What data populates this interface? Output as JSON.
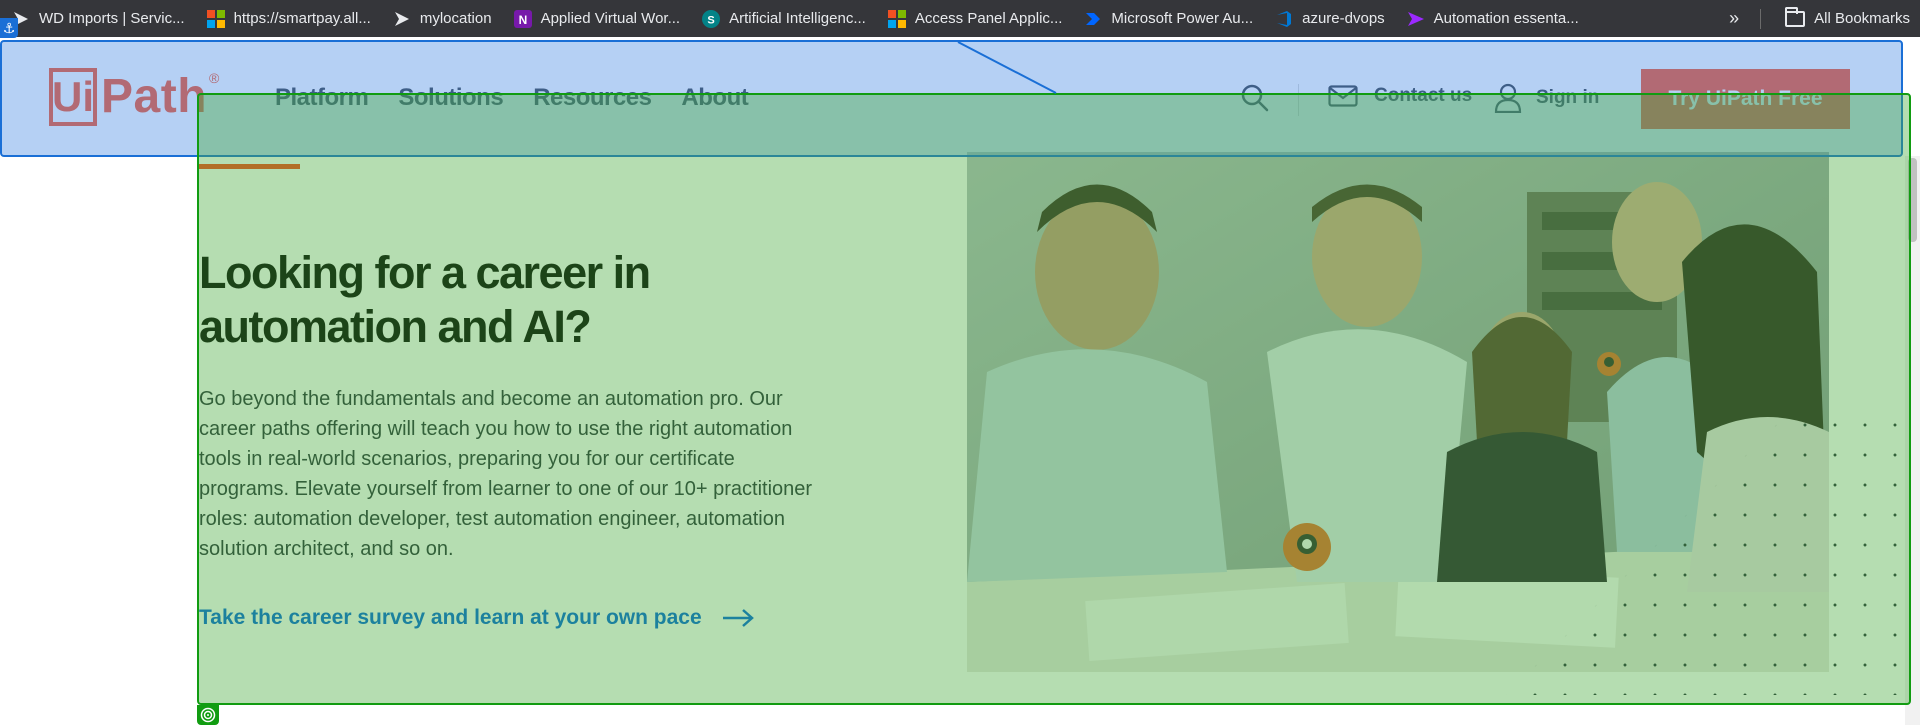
{
  "bookmarks": [
    {
      "label": "WD Imports | Servic...",
      "icon": "servicenow-icon",
      "color": "#62d84e"
    },
    {
      "label": "https://smartpay.all...",
      "icon": "microsoft-icon",
      "color": "#f25022"
    },
    {
      "label": "mylocation",
      "icon": "servicenow-icon",
      "color": "#62d84e"
    },
    {
      "label": "Applied Virtual Wor...",
      "icon": "onenote-icon",
      "color": "#7719aa"
    },
    {
      "label": "Artificial Intelligenc...",
      "icon": "sharepoint-icon",
      "color": "#038387"
    },
    {
      "label": "Access Panel Applic...",
      "icon": "microsoft-icon",
      "color": "#f25022"
    },
    {
      "label": "Microsoft Power Au...",
      "icon": "power-automate-icon",
      "color": "#0066ff"
    },
    {
      "label": "azure-dvops",
      "icon": "azure-devops-icon",
      "color": "#0078d4"
    },
    {
      "label": "Automation essenta...",
      "icon": "power-apps-icon",
      "color": "#9b29ff"
    }
  ],
  "bookmarks_overflow": "»",
  "all_bookmarks": "All Bookmarks",
  "logo": {
    "ui": "Ui",
    "path": "Path",
    "reg": "®"
  },
  "nav": [
    "Platform",
    "Solutions",
    "Resources",
    "About"
  ],
  "header": {
    "contact": "Contact us",
    "signin": "Sign in",
    "cta": "Try UiPath Free"
  },
  "hero": {
    "title": "Looking for a career in automation and AI?",
    "body": "Go beyond the fundamentals and become an automation pro. Our career paths offering will teach you how to use the right automation tools in real-world scenarios, preparing you for our certificate programs. Elevate yourself from learner to one of our 10+ practitioner roles: automation developer, test automation engineer, automation solution architect, and so on.",
    "link": "Take the career survey and learn at your own pace"
  },
  "colors": {
    "brand": "#fa4616",
    "link": "#0067df",
    "text": "#273139",
    "overlay_blue": "#1a6fd6",
    "overlay_green": "#119c11"
  }
}
